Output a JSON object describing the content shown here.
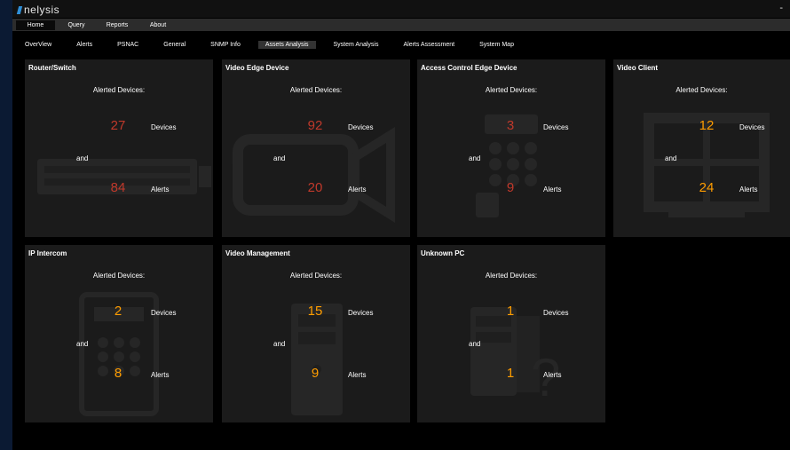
{
  "app": {
    "logo_text": "nelysis",
    "minimize_glyph": "-"
  },
  "menu": [
    "Home",
    "Query",
    "Reports",
    "About"
  ],
  "tabs": [
    "OverView",
    "Alerts",
    "PSNAC",
    "General",
    "SNMP Info",
    "Assets Analysis",
    "System Analysis",
    "Alerts Assessment",
    "System Map"
  ],
  "active_tab": "Assets Analysis",
  "cards": [
    {
      "title": "Router/Switch",
      "alerted_label": "Alerted Devices:",
      "devices": "27",
      "devices_label": "Devices",
      "and_label": "and",
      "alerts": "84",
      "alerts_label": "Alerts",
      "color": "#c0392b",
      "icon": "switch-icon"
    },
    {
      "title": "Video Edge Device",
      "alerted_label": "Alerted Devices:",
      "devices": "92",
      "devices_label": "Devices",
      "and_label": "and",
      "alerts": "20",
      "alerts_label": "Alerts",
      "color": "#c0392b",
      "icon": "camera-icon"
    },
    {
      "title": "Access Control Edge Device",
      "alerted_label": "Alerted Devices:",
      "devices": "3",
      "devices_label": "Devices",
      "and_label": "and",
      "alerts": "9",
      "alerts_label": "Alerts",
      "color": "#c0392b",
      "icon": "keypad-icon"
    },
    {
      "title": "Video Client",
      "alerted_label": "Alerted Devices:",
      "devices": "12",
      "devices_label": "Devices",
      "and_label": "and",
      "alerts": "24",
      "alerts_label": "Alerts",
      "color": "#ff9d00",
      "icon": "monitor-icon"
    },
    {
      "title": "IP Intercom",
      "alerted_label": "Alerted Devices:",
      "devices": "2",
      "devices_label": "Devices",
      "and_label": "and",
      "alerts": "8",
      "alerts_label": "Alerts",
      "color": "#ff9d00",
      "icon": "intercom-icon"
    },
    {
      "title": "Video Management",
      "alerted_label": "Alerted Devices:",
      "devices": "15",
      "devices_label": "Devices",
      "and_label": "and",
      "alerts": "9",
      "alerts_label": "Alerts",
      "color": "#ff9d00",
      "icon": "server-icon"
    },
    {
      "title": "Unknown PC",
      "alerted_label": "Alerted Devices:",
      "devices": "1",
      "devices_label": "Devices",
      "and_label": "and",
      "alerts": "1",
      "alerts_label": "Alerts",
      "color": "#ff9d00",
      "icon": "unknown-pc-icon"
    }
  ]
}
